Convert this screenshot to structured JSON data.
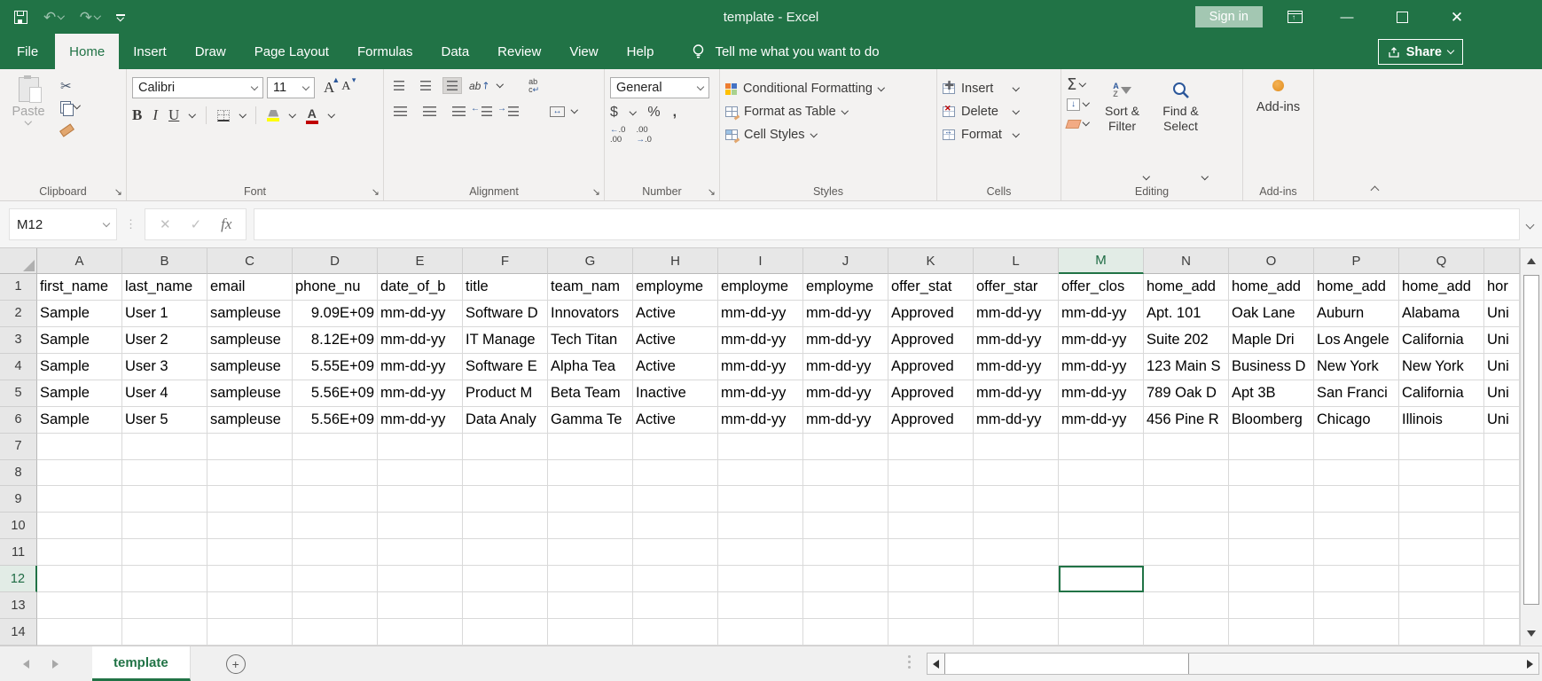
{
  "window": {
    "title": "template  -  Excel",
    "sign_in": "Sign in"
  },
  "tabs": {
    "items": [
      "File",
      "Home",
      "Insert",
      "Draw",
      "Page Layout",
      "Formulas",
      "Data",
      "Review",
      "View",
      "Help"
    ],
    "active": "Home",
    "tell_me": "Tell me what you want to do",
    "share": "Share"
  },
  "ribbon": {
    "clipboard": {
      "group_label": "Clipboard",
      "paste": "Paste"
    },
    "font": {
      "group_label": "Font",
      "family": "Calibri",
      "size": "11"
    },
    "alignment": {
      "group_label": "Alignment"
    },
    "number": {
      "group_label": "Number",
      "format": "General"
    },
    "styles": {
      "group_label": "Styles",
      "conditional_formatting": "Conditional Formatting",
      "format_as_table": "Format as Table",
      "cell_styles": "Cell Styles"
    },
    "cells": {
      "group_label": "Cells",
      "insert": "Insert",
      "delete": "Delete",
      "format": "Format"
    },
    "editing": {
      "group_label": "Editing",
      "sort_filter": "Sort & Filter",
      "find_select": "Find & Select"
    },
    "addins": {
      "group_label": "Add-ins",
      "button": "Add-ins"
    }
  },
  "formula_bar": {
    "name_box": "M12",
    "fx_label": "fx",
    "formula_value": ""
  },
  "sheet": {
    "active_cell": "M12",
    "column_letters": [
      "A",
      "B",
      "C",
      "D",
      "E",
      "F",
      "G",
      "H",
      "I",
      "J",
      "K",
      "L",
      "M",
      "N",
      "O",
      "P",
      "Q",
      ""
    ],
    "row_numbers": [
      "1",
      "2",
      "3",
      "4",
      "5",
      "6",
      "7",
      "8",
      "9",
      "10",
      "11",
      "12",
      "13",
      "14"
    ],
    "rows": [
      [
        "first_name",
        "last_name",
        "email",
        "phone_nu",
        "date_of_b",
        "title",
        "team_nam",
        "employme",
        "employme",
        "employme",
        "offer_stat",
        "offer_star",
        "offer_clos",
        "home_add",
        "home_add",
        "home_add",
        "home_add",
        "hor"
      ],
      [
        "Sample",
        "User 1",
        "sampleuse",
        "9.09E+09",
        "mm-dd-yy",
        "Software D",
        "Innovators",
        "Active",
        "mm-dd-yy",
        "mm-dd-yy",
        "Approved",
        "mm-dd-yy",
        "mm-dd-yy",
        "Apt. 101",
        "Oak Lane",
        "Auburn",
        "Alabama",
        "Uni"
      ],
      [
        "Sample",
        "User 2",
        "sampleuse",
        "8.12E+09",
        "mm-dd-yy",
        "IT Manage",
        "Tech Titan",
        "Active",
        "mm-dd-yy",
        "mm-dd-yy",
        "Approved",
        "mm-dd-yy",
        "mm-dd-yy",
        "Suite 202",
        "Maple Dri",
        "Los Angele",
        "California",
        "Uni"
      ],
      [
        "Sample",
        "User 3",
        "sampleuse",
        "5.55E+09",
        "mm-dd-yy",
        "Software E",
        "Alpha Tea",
        "Active",
        "mm-dd-yy",
        "mm-dd-yy",
        "Approved",
        "mm-dd-yy",
        "mm-dd-yy",
        "123 Main S",
        "Business D",
        "New York",
        "New York",
        "Uni"
      ],
      [
        "Sample",
        "User 4",
        "sampleuse",
        "5.56E+09",
        "mm-dd-yy",
        "Product M",
        "Beta Team",
        "Inactive",
        "mm-dd-yy",
        "mm-dd-yy",
        "Approved",
        "mm-dd-yy",
        "mm-dd-yy",
        "789 Oak D",
        "Apt 3B",
        "San Franci",
        "California",
        "Uni"
      ],
      [
        "Sample",
        "User 5",
        "sampleuse",
        "5.56E+09",
        "mm-dd-yy",
        "Data Analy",
        "Gamma Te",
        "Active",
        "mm-dd-yy",
        "mm-dd-yy",
        "Approved",
        "mm-dd-yy",
        "mm-dd-yy",
        "456 Pine R",
        "Bloomberg",
        "Chicago",
        "Illinois",
        "Uni"
      ]
    ]
  },
  "sheet_tabs": {
    "active_tab": "template"
  },
  "colors": {
    "excel_green": "#217346",
    "sign_in_bg": "#a3c7b2",
    "fill_color_yellow": "#ffff00",
    "font_color_red": "#c00000",
    "addins_orange": "#e08c1e",
    "ribbon_bg": "#f3f2f1",
    "gridline": "#d9d9d9"
  }
}
